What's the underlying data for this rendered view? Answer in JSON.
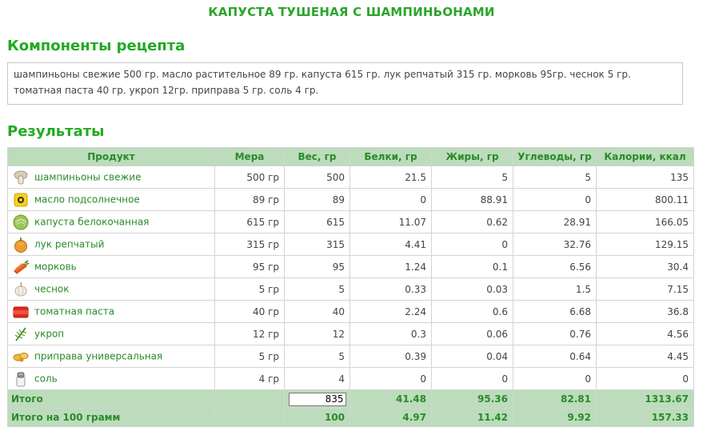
{
  "title": "КАПУСТА ТУШЕНАЯ С ШАМПИНЬОНАМИ",
  "components_heading": "Компоненты рецепта",
  "components_text": "шампиньоны свежие 500 гр. масло растительное 89 гр. капуста 615 гр. лук репчатый 315 гр. морковь 95гр. чеснок 5 гр. томатная паста 40 гр. укроп 12гр. приправа 5 гр. соль 4 гр.",
  "results_heading": "Результаты",
  "columns": [
    "Продукт",
    "Мера",
    "Вес, гр",
    "Белки, гр",
    "Жиры, гр",
    "Углеводы, гр",
    "Калории, ккал"
  ],
  "rows": [
    {
      "icon": "mushroom-icon",
      "product": "шампиньоны свежие",
      "measure": "500 гр",
      "weight": "500",
      "protein": "21.5",
      "fat": "5",
      "carbs": "5",
      "kcal": "135"
    },
    {
      "icon": "oil-icon",
      "product": "масло подсолнечное",
      "measure": "89 гр",
      "weight": "89",
      "protein": "0",
      "fat": "88.91",
      "carbs": "0",
      "kcal": "800.11"
    },
    {
      "icon": "cabbage-icon",
      "product": "капуста белокочанная",
      "measure": "615 гр",
      "weight": "615",
      "protein": "11.07",
      "fat": "0.62",
      "carbs": "28.91",
      "kcal": "166.05"
    },
    {
      "icon": "onion-icon",
      "product": "лук репчатый",
      "measure": "315 гр",
      "weight": "315",
      "protein": "4.41",
      "fat": "0",
      "carbs": "32.76",
      "kcal": "129.15"
    },
    {
      "icon": "carrot-icon",
      "product": "морковь",
      "measure": "95 гр",
      "weight": "95",
      "protein": "1.24",
      "fat": "0.1",
      "carbs": "6.56",
      "kcal": "30.4"
    },
    {
      "icon": "garlic-icon",
      "product": "чеснок",
      "measure": "5 гр",
      "weight": "5",
      "protein": "0.33",
      "fat": "0.03",
      "carbs": "1.5",
      "kcal": "7.15"
    },
    {
      "icon": "tomato-paste-icon",
      "product": "томатная паста",
      "measure": "40 гр",
      "weight": "40",
      "protein": "2.24",
      "fat": "0.6",
      "carbs": "6.68",
      "kcal": "36.8"
    },
    {
      "icon": "dill-icon",
      "product": "укроп",
      "measure": "12 гр",
      "weight": "12",
      "protein": "0.3",
      "fat": "0.06",
      "carbs": "0.76",
      "kcal": "4.56"
    },
    {
      "icon": "seasoning-icon",
      "product": "приправа универсальная",
      "measure": "5 гр",
      "weight": "5",
      "protein": "0.39",
      "fat": "0.04",
      "carbs": "0.64",
      "kcal": "4.45"
    },
    {
      "icon": "salt-icon",
      "product": "соль",
      "measure": "4 гр",
      "weight": "4",
      "protein": "0",
      "fat": "0",
      "carbs": "0",
      "kcal": "0"
    }
  ],
  "totals": {
    "label": "Итого",
    "weight": "835",
    "protein": "41.48",
    "fat": "95.36",
    "carbs": "82.81",
    "kcal": "1313.67"
  },
  "per100": {
    "label": "Итого на 100 грамм",
    "weight": "100",
    "protein": "4.97",
    "fat": "11.42",
    "carbs": "9.92",
    "kcal": "157.33"
  }
}
